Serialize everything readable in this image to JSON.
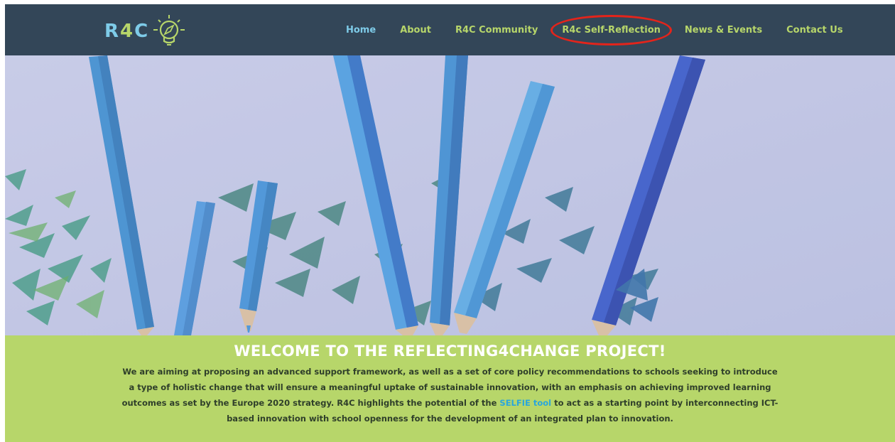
{
  "logo": {
    "text_r": "R",
    "text_four": "4",
    "text_c": "C",
    "icon": "lightbulb-compass-icon"
  },
  "nav": {
    "items": [
      {
        "label": "Home",
        "active": true
      },
      {
        "label": "About"
      },
      {
        "label": "R4C Community"
      },
      {
        "label": "R4c Self-Reflection",
        "circled": true
      },
      {
        "label": "News & Events"
      },
      {
        "label": "Contact Us"
      }
    ]
  },
  "welcome": {
    "title": "WELCOME TO THE REFLECTING4CHANGE PROJECT!",
    "text_before": "We are aiming at proposing an advanced support framework, as well as a set of core policy recommendations to schools seeking to introduce a type of holistic change that will ensure a meaningful uptake of sustainable innovation, with an emphasis on achieving improved learning outcomes as set by the Europe 2020 strategy. R4C highlights the potential of the ",
    "link": "SELFIE tool",
    "text_after": " to act as a starting point by interconnecting ICT-based innovation with school openness for the development of an integrated plan to innovation."
  },
  "colors": {
    "navbar": "#334658",
    "nav_text": "#b7d66a",
    "nav_active": "#7ecbe8",
    "highlight_circle": "#e3241b",
    "band": "#b7d66a",
    "link": "#2aa6dc"
  }
}
